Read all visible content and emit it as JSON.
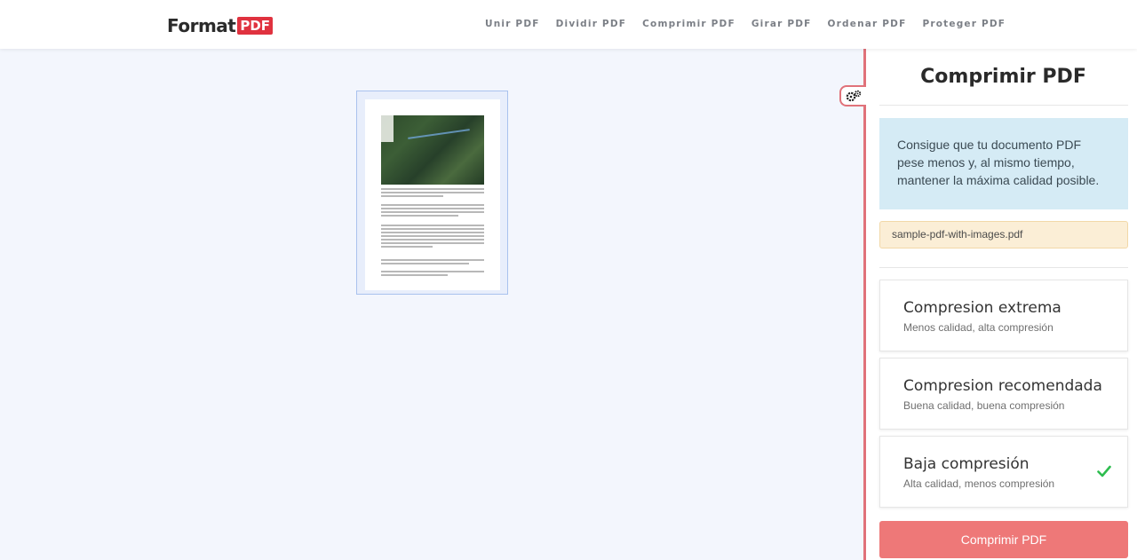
{
  "header": {
    "logo_word": "Format",
    "logo_badge": "PDF",
    "nav": [
      {
        "label": "Unir PDF"
      },
      {
        "label": "Dividir PDF"
      },
      {
        "label": "Comprimir PDF"
      },
      {
        "label": "Girar PDF"
      },
      {
        "label": "Ordenar PDF"
      },
      {
        "label": "Proteger PDF"
      }
    ]
  },
  "settings_toggle": {
    "icon": "gears-icon"
  },
  "sidebar": {
    "title": "Comprimir PDF",
    "description": "Consigue que tu documento PDF pese menos y, al mismo tiempo, mantener la máxima calidad posible.",
    "file_name": "sample-pdf-with-images.pdf",
    "options": [
      {
        "title": "Compresion extrema",
        "subtitle": "Menos calidad, alta compresión",
        "selected": false
      },
      {
        "title": "Compresion recomendada",
        "subtitle": "Buena calidad, buena compresión",
        "selected": false
      },
      {
        "title": "Baja compresión",
        "subtitle": "Alta calidad, menos compresión",
        "selected": true
      }
    ],
    "submit_label": "Comprimir PDF"
  },
  "colors": {
    "accent": "#ee7878",
    "divider": "#e0727a",
    "info_bg": "#d5ebf5",
    "file_bg": "#fbeed6",
    "check": "#2ebd4f",
    "logo_badge": "#e0323f"
  }
}
